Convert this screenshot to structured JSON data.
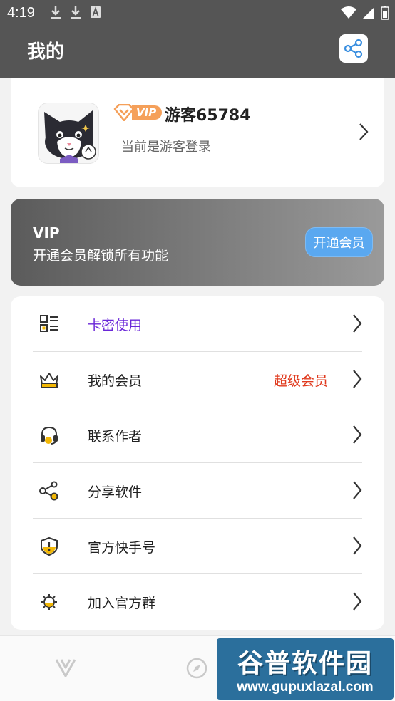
{
  "status_bar": {
    "time": "4:19",
    "left_icons": [
      "download-icon",
      "download-icon",
      "font-icon"
    ],
    "right_icons": [
      "wifi-icon",
      "signal-icon",
      "battery-icon"
    ]
  },
  "header": {
    "title": "我的",
    "share_icon": "share-icon"
  },
  "profile": {
    "vip_tag": "VIP",
    "username": "游客65784",
    "status": "当前是游客登录"
  },
  "vip_banner": {
    "title": "VIP",
    "subtitle": "开通会员解锁所有功能",
    "button_label": "开通会员"
  },
  "menu": {
    "items": [
      {
        "icon": "qr-code-icon",
        "label": "卡密使用",
        "right_text": ""
      },
      {
        "icon": "crown-icon",
        "label": "我的会员",
        "right_text": "超级会员"
      },
      {
        "icon": "headset-icon",
        "label": "联系作者",
        "right_text": ""
      },
      {
        "icon": "share-icon",
        "label": "分享软件",
        "right_text": ""
      },
      {
        "icon": "shield-alert-icon",
        "label": "官方快手号",
        "right_text": ""
      },
      {
        "icon": "gear-icon",
        "label": "加入官方群",
        "right_text": ""
      }
    ]
  },
  "bottom_nav": {
    "items": [
      {
        "icon": "home-v-icon"
      },
      {
        "icon": "compass-icon"
      }
    ]
  },
  "watermark": {
    "top": "谷普软件园",
    "bottom": "www.gupuxlazal.com"
  },
  "colors": {
    "header_bg": "#555555",
    "accent_purple": "#6a27d8",
    "accent_red": "#e03a1e",
    "vip_button": "#5aa8f0",
    "vip_tag": "#f5a05a",
    "icon_yellow": "#f2b705"
  }
}
